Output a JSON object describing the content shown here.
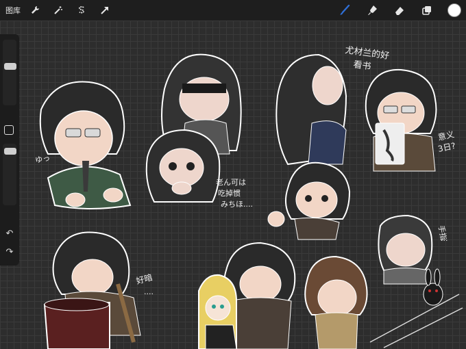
{
  "toolbar": {
    "gallery_label": "图库",
    "tools_left": [
      "wrench-icon",
      "magic-wand-icon",
      "selection-s-icon",
      "arrow-transform-icon"
    ],
    "tools_right": [
      "brush-icon",
      "smudge-icon",
      "eraser-icon",
      "layers-icon",
      "color-swatch"
    ],
    "active_color": "#ffffff",
    "brush_accent": "#2f6fd6"
  },
  "canvas": {
    "background": "#2d2d2d",
    "grid": true
  },
  "annotations": {
    "top_right_1": "尤材兰的好",
    "top_right_2": "看书",
    "coffee_line_1": "意义",
    "coffee_line_2": "3日?",
    "middle_1": "老ん可は",
    "middle_2": "吃掉惯",
    "middle_3": "みちほ....",
    "lower_left": "好暗",
    "lower_left_2": "....",
    "bottom_right": "手指",
    "bottom_right_2": "...",
    "small_left": "ゆっ"
  }
}
